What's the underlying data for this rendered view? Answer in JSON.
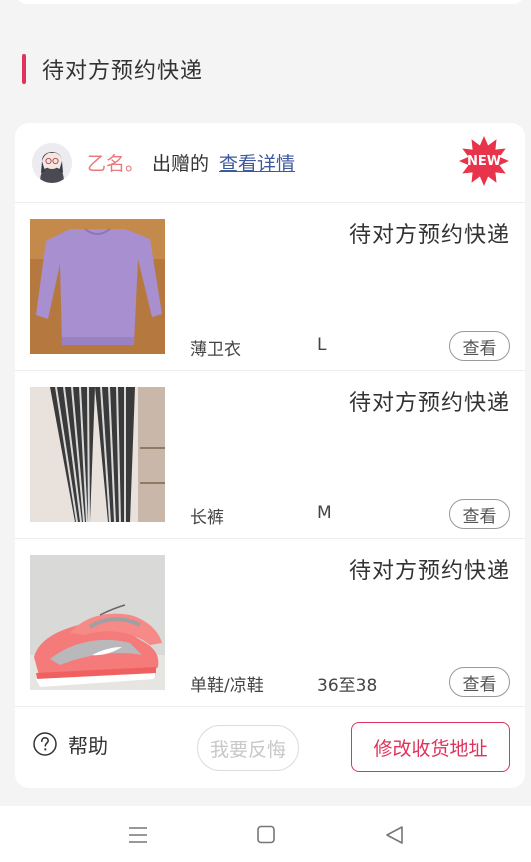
{
  "section": {
    "title": "待对方预约快递"
  },
  "card": {
    "donor_name": "乙名。",
    "donate_label": "出赠的",
    "view_detail": "查看详情",
    "badge": "NEW"
  },
  "items": [
    {
      "status": "待对方预约快递",
      "name": "薄卫衣",
      "size": "L",
      "view_label": "查看",
      "photo": "purple-longsleeve-top"
    },
    {
      "status": "待对方预约快递",
      "name": "长裤",
      "size": "M",
      "view_label": "查看",
      "photo": "striped-wide-leg-pants"
    },
    {
      "status": "待对方预约快递",
      "name": "单鞋/凉鞋",
      "size": "36至38",
      "view_label": "查看",
      "photo": "grey-coral-sneakers"
    }
  ],
  "footer": {
    "help_label": "帮助",
    "regret_label": "我要反悔",
    "address_label": "修改收货地址"
  },
  "nav": {
    "icons": [
      "menu-icon",
      "home-square-icon",
      "back-triangle-icon"
    ]
  },
  "colors": {
    "accent": "#e0325a",
    "donor": "#e8787c",
    "link": "#3d5a9e",
    "background": "#f4f4f4"
  }
}
